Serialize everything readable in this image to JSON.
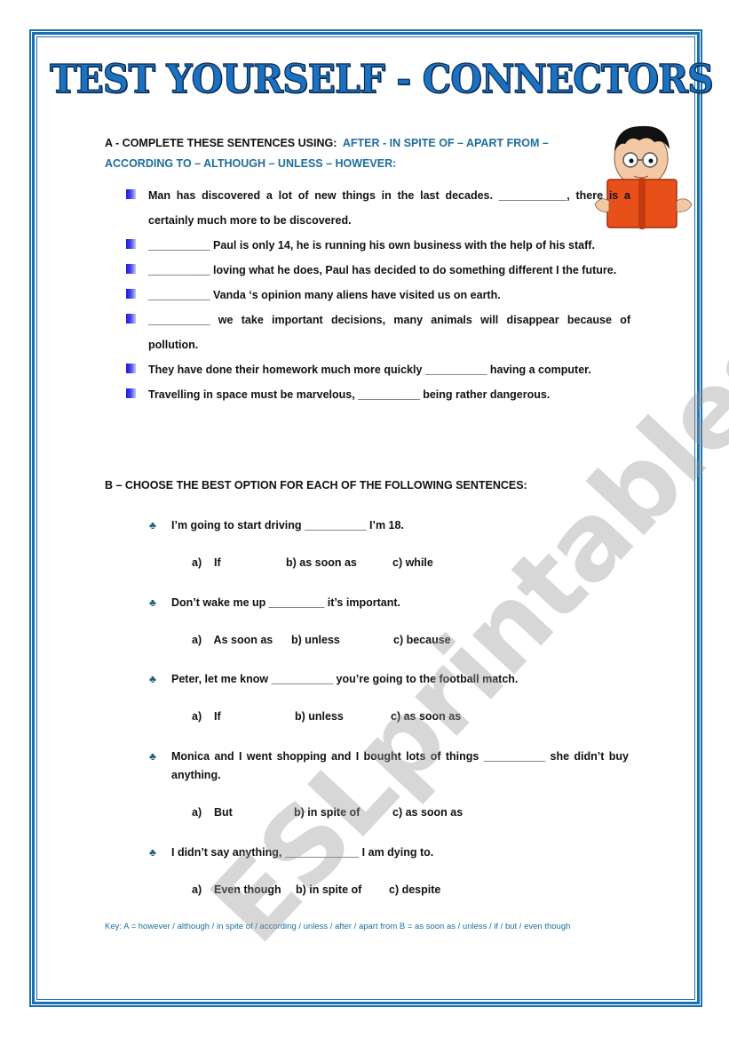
{
  "title": "TEST YOURSELF - CONNECTORS",
  "watermark": "ESLprintables.com",
  "section_a": {
    "heading": "A - COMPLETE THESE SENTENCES USING:",
    "words": "AFTER - IN SPITE OF – APART FROM – ACCORDING TO – ALTHOUGH – UNLESS – HOWEVER:",
    "items": [
      "Man has discovered a lot of new things in the last decades. ___________, there is a certainly much more to be discovered.",
      "__________ Paul is only 14, he is running his own business with the help of his staff.",
      "__________ loving what he does, Paul has decided to do something different I the future.",
      "__________ Vanda ‘s opinion many aliens have visited us on earth.",
      "__________ we take important decisions, many animals will disappear because of pollution.",
      "They have done their homework much more quickly __________ having a computer.",
      "Travelling in space must be marvelous, __________ being rather dangerous."
    ]
  },
  "section_b": {
    "heading": "B – CHOOSE THE BEST OPTION FOR EACH OF THE FOLLOWING SENTENCES:",
    "questions": [
      {
        "text": "I’m going to start driving __________ I’m 18.",
        "a": "a)    If",
        "b": "b) as soon as",
        "c": "c) while"
      },
      {
        "text": "Don’t wake me up _________ it’s important.",
        "a": "a)    As soon as",
        "b": "b) unless",
        "c": "c) because"
      },
      {
        "text": "Peter, let me know __________ you’re going to the football match.",
        "a": "a)    If",
        "b": "b) unless",
        "c": "c) as soon as"
      },
      {
        "text": "Monica and I went shopping and I bought lots of things __________ she didn’t buy anything.",
        "a": "a)    But",
        "b": "b) in spite of",
        "c": "c) as soon as"
      },
      {
        "text": "I didn’t say anything, ____________ I am dying to.",
        "a": "a)    Even though",
        "b": "b) in spite of",
        "c": "c) despite"
      }
    ]
  },
  "key": "Key: A = however / although / in spite of / according / unless / after / apart from      B = as soon as / unless / if / but / even though",
  "colors": {
    "border": "#1a6fae",
    "title": "#1a72c0",
    "accent_text": "#1b6e9e",
    "bullet": "#1a1ad0"
  }
}
